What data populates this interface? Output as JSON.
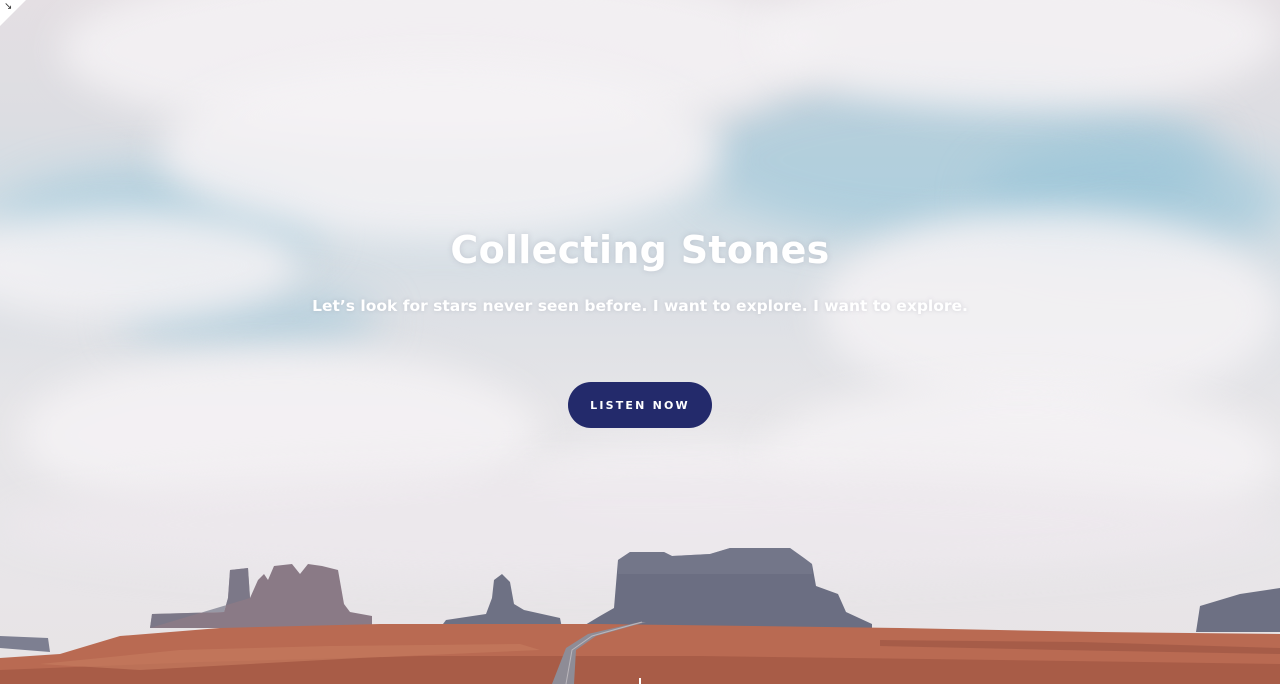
{
  "hero": {
    "title": "Collecting Stones",
    "subtitle": "Let’s look for stars never seen before. I want to explore. I want to explore.",
    "cta_label": "LISTEN NOW"
  },
  "icons": {
    "corner": "expand-arrow-icon",
    "scroll": "scroll-indicator"
  },
  "colors": {
    "button_bg": "#232a6b",
    "text": "#ffffff",
    "sky": "#cfdde5",
    "desert": "#b8664d",
    "butte": "#6f6f82"
  }
}
